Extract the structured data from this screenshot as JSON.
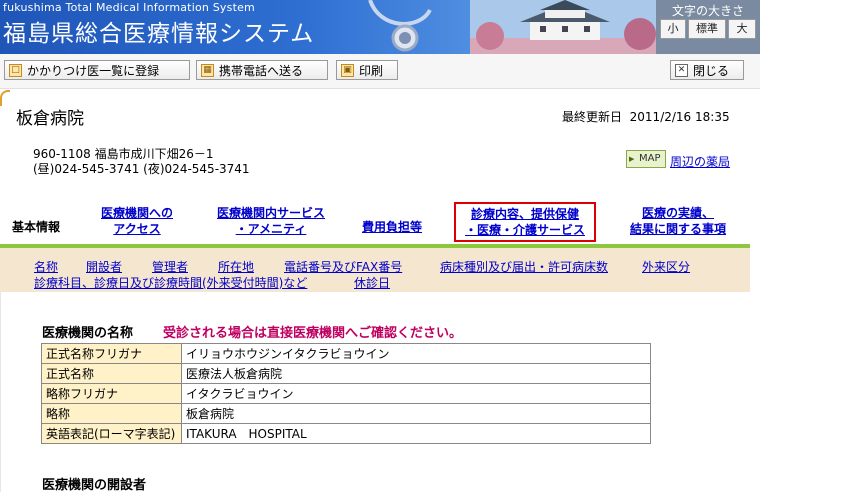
{
  "header": {
    "en_title": "fukushima Total Medical Information System",
    "jp_title": "福島県総合医療情報システム",
    "font_size": {
      "label": "文字の大きさ",
      "small": "小",
      "standard": "標準",
      "large": "大"
    }
  },
  "toolbar": {
    "register": "かかりつけ医一覧に登録",
    "send_mobile": "携帯電話へ送る",
    "print": "印刷",
    "close": "閉じる"
  },
  "hospital": {
    "name": "板倉病院",
    "updated_label": "最終更新日",
    "updated": "2011/2/16 18:35",
    "address": "960-1108 福島市成川下畑26－1",
    "phones": "(昼)024-545-3741 (夜)024-545-3741",
    "map_label": "MAP",
    "nearby_pharmacy": "周辺の薬局"
  },
  "tabs": {
    "basic": "基本情報",
    "access_1": "医療機関への",
    "access_2": "アクセス",
    "service_1": "医療機関内サービス",
    "service_2": "・アメニティ",
    "cost": "費用負担等",
    "care_1": "診療内容、提供保健",
    "care_2": "・医療・介護サービス",
    "results_1": "医療の実績、",
    "results_2": "結果に関する事項"
  },
  "subnav": {
    "name": "名称",
    "founder": "開設者",
    "manager": "管理者",
    "location": "所在地",
    "phone_fax": "電話番号及びFAX番号",
    "beds": "病床種別及び届出・許可病床数",
    "outpatient": "外来区分",
    "departments": "診療科目、診療日及び診療時間(外来受付時間)など",
    "holidays": "休診日"
  },
  "content": {
    "section1": "医療機関の名称",
    "notice": "受診される場合は直接医療機関へご確認ください。",
    "rows": [
      {
        "k": "正式名称フリガナ",
        "v": "イリョウホウジンイタクラビョウイン"
      },
      {
        "k": "正式名称",
        "v": "医療法人板倉病院"
      },
      {
        "k": "略称フリガナ",
        "v": "イタクラビョウイン"
      },
      {
        "k": "略称",
        "v": "板倉病院"
      },
      {
        "k": "英語表記(ローマ字表記)",
        "v": "ITAKURA　HOSPITAL"
      }
    ],
    "section2": "医療機関の開設者"
  }
}
